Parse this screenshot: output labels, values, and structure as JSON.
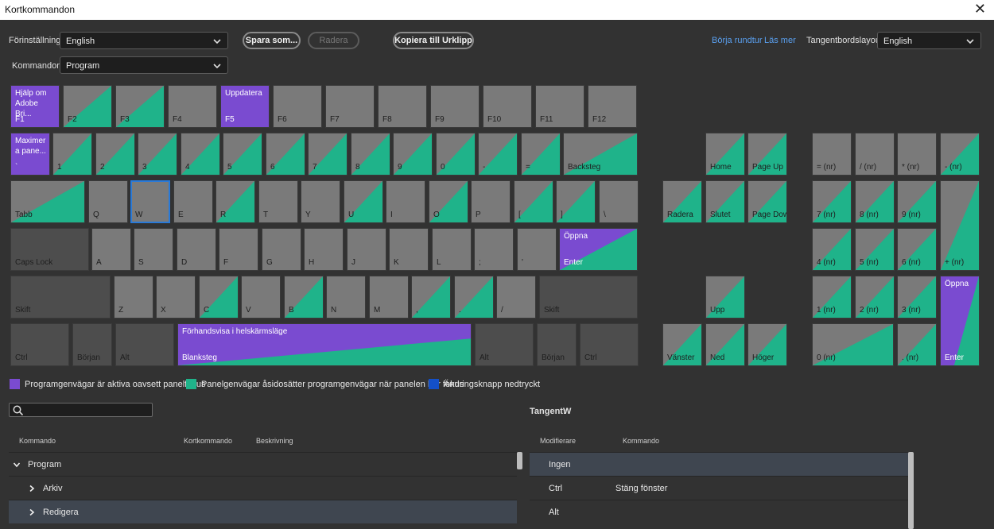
{
  "window": {
    "title": "Kortkommandon"
  },
  "toolbar": {
    "preset_label": "Förinställning:",
    "preset_value": "English",
    "save_as_label": "Spara som...",
    "delete_label": "Radera",
    "copy_label": "Kopiera till Urklipp",
    "tour_label": "Börja rundtur",
    "learn_label": "Läs mer",
    "layout_label": "Tangentbordslayout:",
    "layout_value": "English",
    "commands_label": "Kommandon:",
    "commands_value": "Program"
  },
  "colors": {
    "key": "#7a7a7a",
    "key_dark": "#4d4d4d",
    "app_shortcut": "#7a4bd0",
    "panel_shortcut": "#1fb38a",
    "modifier": "#1450c8",
    "selected_outline": "#2a7ad8"
  },
  "keys": {
    "f1": {
      "top": "Hjälp om Adobe Bri...",
      "bottom": "F1"
    },
    "f2": {
      "bottom": "F2"
    },
    "f3": {
      "bottom": "F3"
    },
    "f4": {
      "bottom": "F4"
    },
    "f5": {
      "top": "Uppdatera",
      "bottom": "F5"
    },
    "f6": {
      "bottom": "F6"
    },
    "f7": {
      "bottom": "F7"
    },
    "f8": {
      "bottom": "F8"
    },
    "f9": {
      "bottom": "F9"
    },
    "f10": {
      "bottom": "F10"
    },
    "f11": {
      "bottom": "F11"
    },
    "f12": {
      "bottom": "F12"
    },
    "grave": {
      "top": "Maximer a pane...",
      "bottom": "`"
    },
    "k1": {
      "bottom": "1"
    },
    "k2": {
      "bottom": "2"
    },
    "k3": {
      "bottom": "3"
    },
    "k4": {
      "bottom": "4"
    },
    "k5": {
      "bottom": "5"
    },
    "k6": {
      "bottom": "6"
    },
    "k7": {
      "bottom": "7"
    },
    "k8": {
      "bottom": "8"
    },
    "k9": {
      "bottom": "9"
    },
    "k0": {
      "bottom": "0"
    },
    "minus": {
      "bottom": "-"
    },
    "equals": {
      "bottom": "="
    },
    "backspace": {
      "bottom": "Backsteg"
    },
    "tab": {
      "bottom": "Tabb"
    },
    "q": {
      "bottom": "Q"
    },
    "w": {
      "bottom": "W"
    },
    "e": {
      "bottom": "E"
    },
    "r": {
      "bottom": "R"
    },
    "t": {
      "bottom": "T"
    },
    "y": {
      "bottom": "Y"
    },
    "u": {
      "bottom": "U"
    },
    "i": {
      "bottom": "I"
    },
    "o": {
      "bottom": "O"
    },
    "p": {
      "bottom": "P"
    },
    "lbracket": {
      "bottom": "["
    },
    "rbracket": {
      "bottom": "]"
    },
    "backslash": {
      "bottom": "\\"
    },
    "capslock": {
      "bottom": "Caps Lock"
    },
    "a": {
      "bottom": "A"
    },
    "s": {
      "bottom": "S"
    },
    "d": {
      "bottom": "D"
    },
    "f": {
      "bottom": "F"
    },
    "g": {
      "bottom": "G"
    },
    "h": {
      "bottom": "H"
    },
    "j": {
      "bottom": "J"
    },
    "k": {
      "bottom": "K"
    },
    "l": {
      "bottom": "L"
    },
    "semicolon": {
      "bottom": ";"
    },
    "quote": {
      "bottom": "'"
    },
    "enter": {
      "top": "Öppna",
      "bottom": "Enter"
    },
    "lshift": {
      "bottom": "Skift"
    },
    "z": {
      "bottom": "Z"
    },
    "x": {
      "bottom": "X"
    },
    "c": {
      "bottom": "C"
    },
    "v": {
      "bottom": "V"
    },
    "b": {
      "bottom": "B"
    },
    "n": {
      "bottom": "N"
    },
    "m": {
      "bottom": "M"
    },
    "comma": {
      "bottom": ","
    },
    "period": {
      "bottom": "."
    },
    "slash": {
      "bottom": "/"
    },
    "rshift": {
      "bottom": "Skift"
    },
    "lctrl": {
      "bottom": "Ctrl"
    },
    "lhome": {
      "bottom": "Början"
    },
    "lalt": {
      "bottom": "Alt"
    },
    "space": {
      "top": "Förhandsvisa i helskärmsläge",
      "bottom": "Blanksteg"
    },
    "ralt": {
      "bottom": "Alt"
    },
    "rhome": {
      "bottom": "Början"
    },
    "rctrl": {
      "bottom": "Ctrl"
    },
    "home": {
      "bottom": "Home"
    },
    "pageup": {
      "bottom": "Page Up"
    },
    "delete": {
      "bottom": "Radera"
    },
    "end": {
      "bottom": "Slutet"
    },
    "pagedown": {
      "bottom": "Page Down"
    },
    "up": {
      "bottom": "Upp"
    },
    "left": {
      "bottom": "Vänster"
    },
    "down": {
      "bottom": "Ned"
    },
    "right": {
      "bottom": "Höger"
    },
    "np_eq": {
      "bottom": "= (nr)"
    },
    "np_div": {
      "bottom": "/ (nr)"
    },
    "np_mul": {
      "bottom": "* (nr)"
    },
    "np_sub": {
      "bottom": "- (nr)"
    },
    "np7": {
      "bottom": "7 (nr)"
    },
    "np8": {
      "bottom": "8 (nr)"
    },
    "np9": {
      "bottom": "9 (nr)"
    },
    "np_add": {
      "bottom": "+ (nr)"
    },
    "np4": {
      "bottom": "4 (nr)"
    },
    "np5": {
      "bottom": "5 (nr)"
    },
    "np6": {
      "bottom": "6 (nr)"
    },
    "np1": {
      "bottom": "1 (nr)"
    },
    "np2": {
      "bottom": "2 (nr)"
    },
    "np3": {
      "bottom": "3 (nr)"
    },
    "np_enter": {
      "top": "Öppna",
      "bottom": "Enter"
    },
    "np0": {
      "bottom": "0 (nr)"
    },
    "np_dot": {
      "bottom": ". (nr)"
    }
  },
  "legend": {
    "app": "Programgenvägar är aktiva oavsett panelfokus",
    "panel": "Panelgenvägar åsidosätter programgenvägar när panelen har fokus",
    "modifier": "Ändringsknapp nedtryckt"
  },
  "key_info": {
    "label": "Tangent:",
    "value": "W"
  },
  "left_table": {
    "headers": [
      "Kommando",
      "Kortkommando",
      "Beskrivning"
    ],
    "rows": [
      {
        "label": "Program",
        "expanded": true
      },
      {
        "label": "Arkiv",
        "expanded": false
      },
      {
        "label": "Redigera",
        "expanded": false
      }
    ]
  },
  "right_table": {
    "headers": [
      "Modifierare",
      "Kommando"
    ],
    "rows": [
      {
        "modifier": "Ingen",
        "command": ""
      },
      {
        "modifier": "Ctrl",
        "command": "Stäng fönster"
      },
      {
        "modifier": "Alt",
        "command": ""
      }
    ]
  }
}
